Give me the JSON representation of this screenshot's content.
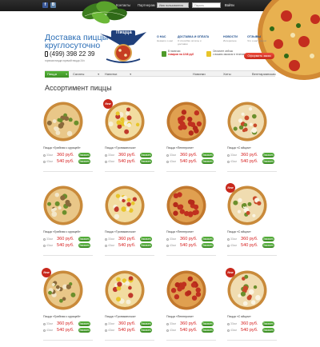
{
  "topbar": {
    "social": [
      {
        "icon": "facebook-icon",
        "glyph": "f"
      },
      {
        "icon": "vk-icon",
        "glyph": "B"
      }
    ],
    "links": [
      "Главная",
      "Контакты",
      "Партнерам"
    ],
    "username_placeholder": "Имя пользователя",
    "password_placeholder": "Пароль",
    "login": "Войти"
  },
  "header": {
    "tagline_line1": "Доставка пиццы",
    "tagline_line2": "круглосуточно",
    "phone": "(499) 398 22 39",
    "subtagline": "горячая пицца горячий пицца 24ч",
    "logo_text": "Пицца",
    "nav": [
      {
        "title": "О НАС",
        "sub": "Немного о нас"
      },
      {
        "title": "ДОСТАВКА И ОПЛАТА",
        "sub": "О способах оплаты и доставки"
      },
      {
        "title": "НОВОСТИ",
        "sub": "Интересное"
      },
      {
        "title": "ОТЗЫВЫ",
        "sub": "Что о нас говорят"
      }
    ],
    "promo1_line1": "В наличии",
    "promo1_line2": "товаров на 1246 руб",
    "promo2_line1": "Оплатите сейчас",
    "promo2_line2": "с вашим заказом в течение 1 минут",
    "order_button": "Оформить заказ"
  },
  "menu": [
    {
      "label": "Пицца",
      "active": true
    },
    {
      "label": "Салаты",
      "active": false
    },
    {
      "label": "Напитки",
      "active": false
    },
    {
      "label": "Новинки",
      "active": false
    },
    {
      "label": "Хиты",
      "active": false
    },
    {
      "label": "Вегетарианская",
      "active": false
    }
  ],
  "section_title": "Ассортимент пиццы",
  "colors": {
    "accent_green": "#4aa32f",
    "price_red": "#d62020",
    "link_blue": "#2a6db5"
  },
  "products": [
    {
      "name": "Пицца «Грибная с курицей»",
      "new": false,
      "s1": "33см",
      "p1": "360 руб.",
      "s2": "43см",
      "p2": "540 руб.",
      "btn": "Заказать",
      "style": "mushroom"
    },
    {
      "name": "Пицца «Тропиканочка»",
      "new": true,
      "badge": "New",
      "s1": "33см",
      "p1": "360 руб.",
      "s2": "43см",
      "p2": "540 руб.",
      "btn": "Заказать",
      "style": "tropic"
    },
    {
      "name": "Пицца «Пепперони»",
      "new": false,
      "s1": "33см",
      "p1": "360 руб.",
      "s2": "43см",
      "p2": "540 руб.",
      "btn": "Заказать",
      "style": "pepperoni"
    },
    {
      "name": "Пицца «С яйцом»",
      "new": false,
      "s1": "33см",
      "p1": "360 руб.",
      "s2": "43см",
      "p2": "540 руб.",
      "btn": "Заказать",
      "style": "egg"
    },
    {
      "name": "Пицца «Грибная с курицей»",
      "new": false,
      "s1": "33см",
      "p1": "360 руб.",
      "s2": "43см",
      "p2": "540 руб.",
      "btn": "Заказать",
      "style": "mushroom"
    },
    {
      "name": "Пицца «Тропиканочка»",
      "new": false,
      "s1": "33см",
      "p1": "360 руб.",
      "s2": "43см",
      "p2": "540 руб.",
      "btn": "Заказать",
      "style": "tropic"
    },
    {
      "name": "Пицца «Пепперони»",
      "new": false,
      "s1": "33см",
      "p1": "360 руб.",
      "s2": "43см",
      "p2": "540 руб.",
      "btn": "Заказать",
      "style": "pepperoni"
    },
    {
      "name": "Пицца «С яйцом»",
      "new": true,
      "badge": "New",
      "s1": "33см",
      "p1": "360 руб.",
      "s2": "43см",
      "p2": "540 руб.",
      "btn": "Заказать",
      "style": "egg"
    },
    {
      "name": "Пицца «Грибная с курицей»",
      "new": true,
      "badge": "New",
      "s1": "33см",
      "p1": "360 руб.",
      "s2": "43см",
      "p2": "540 руб.",
      "btn": "Заказать",
      "style": "mushroom"
    },
    {
      "name": "Пицца «Тропиканочка»",
      "new": false,
      "s1": "33см",
      "p1": "360 руб.",
      "s2": "43см",
      "p2": "540 руб.",
      "btn": "Заказать",
      "style": "tropic"
    },
    {
      "name": "Пицца «Пепперони»",
      "new": false,
      "s1": "33см",
      "p1": "360 руб.",
      "s2": "43см",
      "p2": "540 руб.",
      "btn": "Заказать",
      "style": "pepperoni"
    },
    {
      "name": "Пицца «С яйцом»",
      "new": true,
      "badge": "New",
      "s1": "33см",
      "p1": "360 руб.",
      "s2": "43см",
      "p2": "540 руб.",
      "btn": "Заказать",
      "style": "egg"
    }
  ]
}
